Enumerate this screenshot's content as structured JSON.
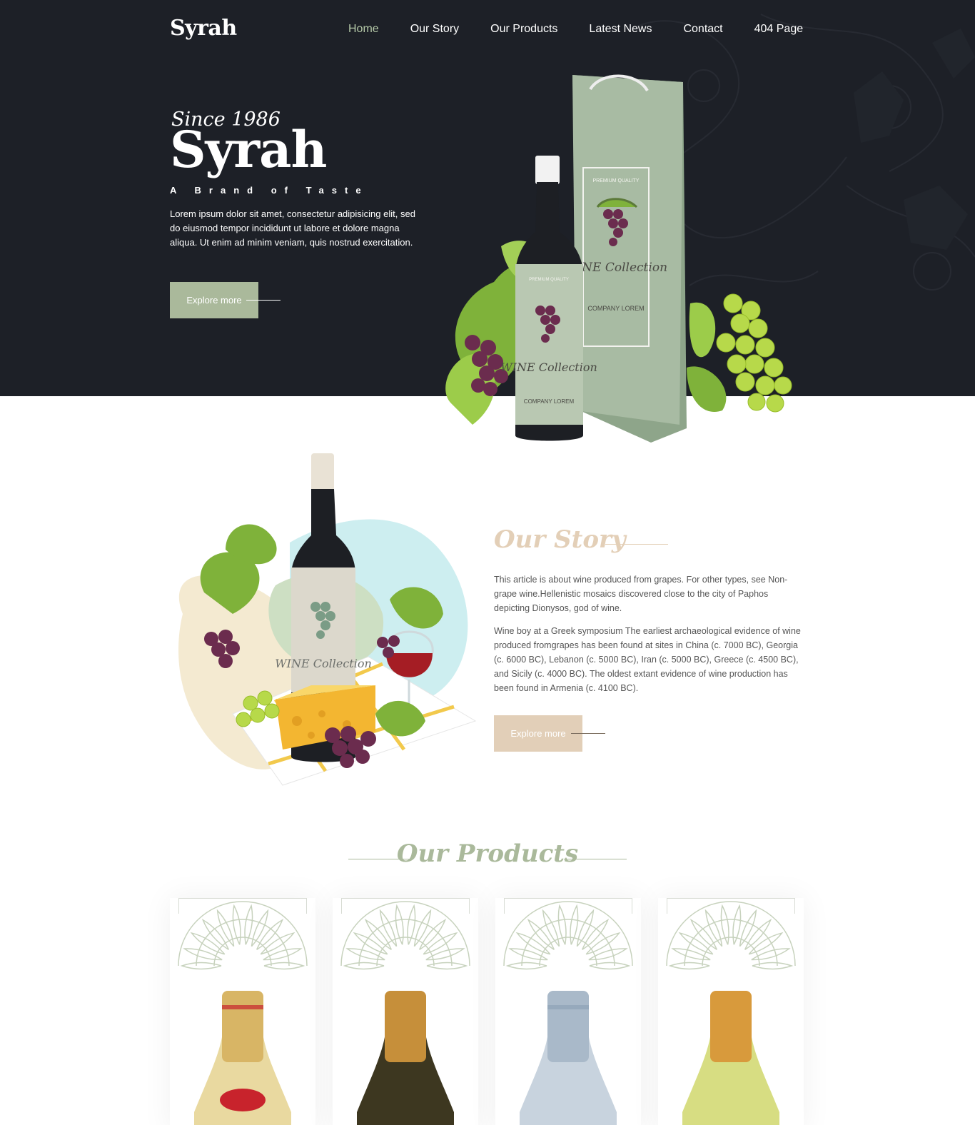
{
  "header": {
    "logo": "Syrah",
    "nav": [
      {
        "label": "Home",
        "active": true
      },
      {
        "label": "Our Story"
      },
      {
        "label": "Our Products"
      },
      {
        "label": "Latest News"
      },
      {
        "label": "Contact"
      },
      {
        "label": "404 Page"
      }
    ]
  },
  "hero": {
    "since": "Since 1986",
    "title": "Syrah",
    "tagline": "A Brand of Taste",
    "text": "Lorem ipsum dolor sit amet, consectetur adipisicing elit, sed do eiusmod tempor incididunt ut labore et dolore magna aliqua. Ut enim ad minim veniam, quis nostrud exercitation.",
    "button": "Explore more",
    "label_bottle": "WINE Collection",
    "label_company": "COMPANY LOREM",
    "label_quality": "PREMIUM QUALITY"
  },
  "story": {
    "title": "Our Story",
    "p1": "This article is about wine produced from grapes. For other types, see Non-grape wine.Hellenistic mosaics discovered close to the city of Paphos depicting Dionysos, god of wine.",
    "p2": "Wine boy at a Greek symposium The earliest archaeological evidence of wine produced fromgrapes has been found at sites in China (c. 7000 BC), Georgia (c. 6000 BC), Lebanon (c. 5000 BC), Iran (c. 5000 BC), Greece (c. 4500 BC), and Sicily (c. 4000 BC). The oldest extant evidence of wine production has been found in Armenia (c. 4100 BC).",
    "button": "Explore more"
  },
  "products": {
    "title": "Our Products",
    "items": [
      {
        "bottle_neck": "#d8b565",
        "bottle_body": "#e9d9a0",
        "accent": "#c8232c"
      },
      {
        "bottle_neck": "#c68f3a",
        "bottle_body": "#3d3720",
        "accent": "#c68f3a"
      },
      {
        "bottle_neck": "#a9b9c9",
        "bottle_body": "#c8d3de",
        "accent": "#8ea2b6"
      },
      {
        "bottle_neck": "#d89a3c",
        "bottle_body": "#d7dd82",
        "accent": "#d89a3c"
      }
    ]
  },
  "colors": {
    "hero_bg": "#1d2027",
    "sage": "#aab99b",
    "sand": "#e2cfb8",
    "active_nav": "#b5c9a8"
  }
}
